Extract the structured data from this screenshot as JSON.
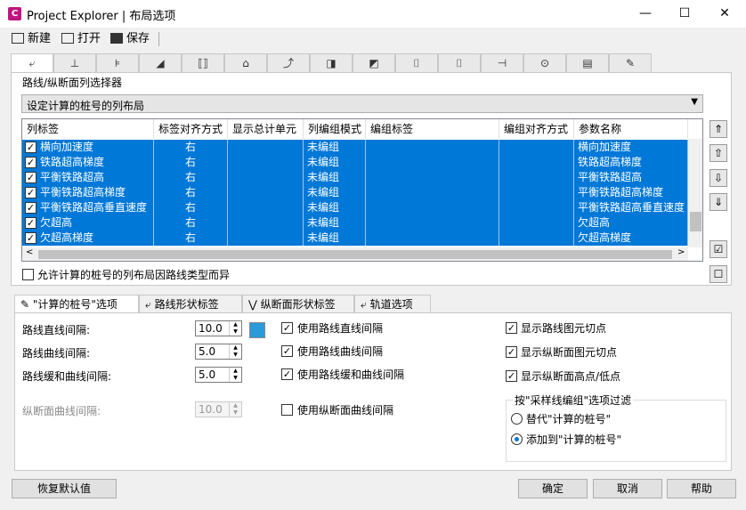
{
  "window": {
    "title": "Project Explorer | 布局选项",
    "app_icon": "C",
    "min": "—",
    "max": "☐",
    "close": "✕"
  },
  "toolbar": {
    "new": "新建",
    "open": "打开",
    "save": "保存"
  },
  "icon_tabs": [
    "⤶",
    "⊥",
    "⊧",
    "◢",
    "⟦⟧",
    "⌂",
    "⤴",
    "◨",
    "◩",
    "⌷",
    "⌷",
    "⊣",
    "⊙",
    "▤",
    "✎"
  ],
  "section_label": "路线/纵断面列选择器",
  "combo_value": "设定计算的桩号的列布局",
  "grid": {
    "headers": [
      "列标签",
      "标签对齐方式",
      "显示总计单元",
      "列编组模式",
      "编组标签",
      "编组对齐方式",
      "参数名称"
    ],
    "rows": [
      {
        "label": "横向加速度",
        "align": "右",
        "mode": "未编组",
        "param": "横向加速度"
      },
      {
        "label": "铁路超高梯度",
        "align": "右",
        "mode": "未编组",
        "param": "铁路超高梯度"
      },
      {
        "label": "平衡铁路超高",
        "align": "右",
        "mode": "未编组",
        "param": "平衡铁路超高"
      },
      {
        "label": "平衡铁路超高梯度",
        "align": "右",
        "mode": "未编组",
        "param": "平衡铁路超高梯度"
      },
      {
        "label": "平衡铁路超高垂直速度",
        "align": "右",
        "mode": "未编组",
        "param": "平衡铁路超高垂直速度"
      },
      {
        "label": "欠超高",
        "align": "右",
        "mode": "未编组",
        "param": "欠超高"
      },
      {
        "label": "欠超高梯度",
        "align": "右",
        "mode": "未编组",
        "param": "欠超高梯度"
      }
    ]
  },
  "allow_label": "允许计算的桩号的列布局因路线类型而异",
  "lower_tabs": [
    "\"计算的桩号\"选项",
    "路线形状标签",
    "纵断面形状标签",
    "轨道选项"
  ],
  "fields": {
    "tangent": {
      "label": "路线直线间隔:",
      "value": "10.0"
    },
    "curve": {
      "label": "路线曲线间隔:",
      "value": "5.0"
    },
    "spiral": {
      "label": "路线缓和曲线间隔:",
      "value": "5.0"
    },
    "vcurve": {
      "label": "纵断面曲线间隔:",
      "value": "10.0"
    }
  },
  "use_checks": [
    "使用路线直线间隔",
    "使用路线曲线间隔",
    "使用路线缓和曲线间隔",
    "使用纵断面曲线间隔"
  ],
  "show_checks": [
    "显示路线图元切点",
    "显示纵断面图元切点",
    "显示纵断面高点/低点"
  ],
  "filter": {
    "title": "按\"采样线编组\"选项过滤",
    "opt1": "替代\"计算的桩号\"",
    "opt2": "添加到\"计算的桩号\""
  },
  "buttons": {
    "restore": "恢复默认值",
    "ok": "确定",
    "cancel": "取消",
    "help": "帮助"
  }
}
